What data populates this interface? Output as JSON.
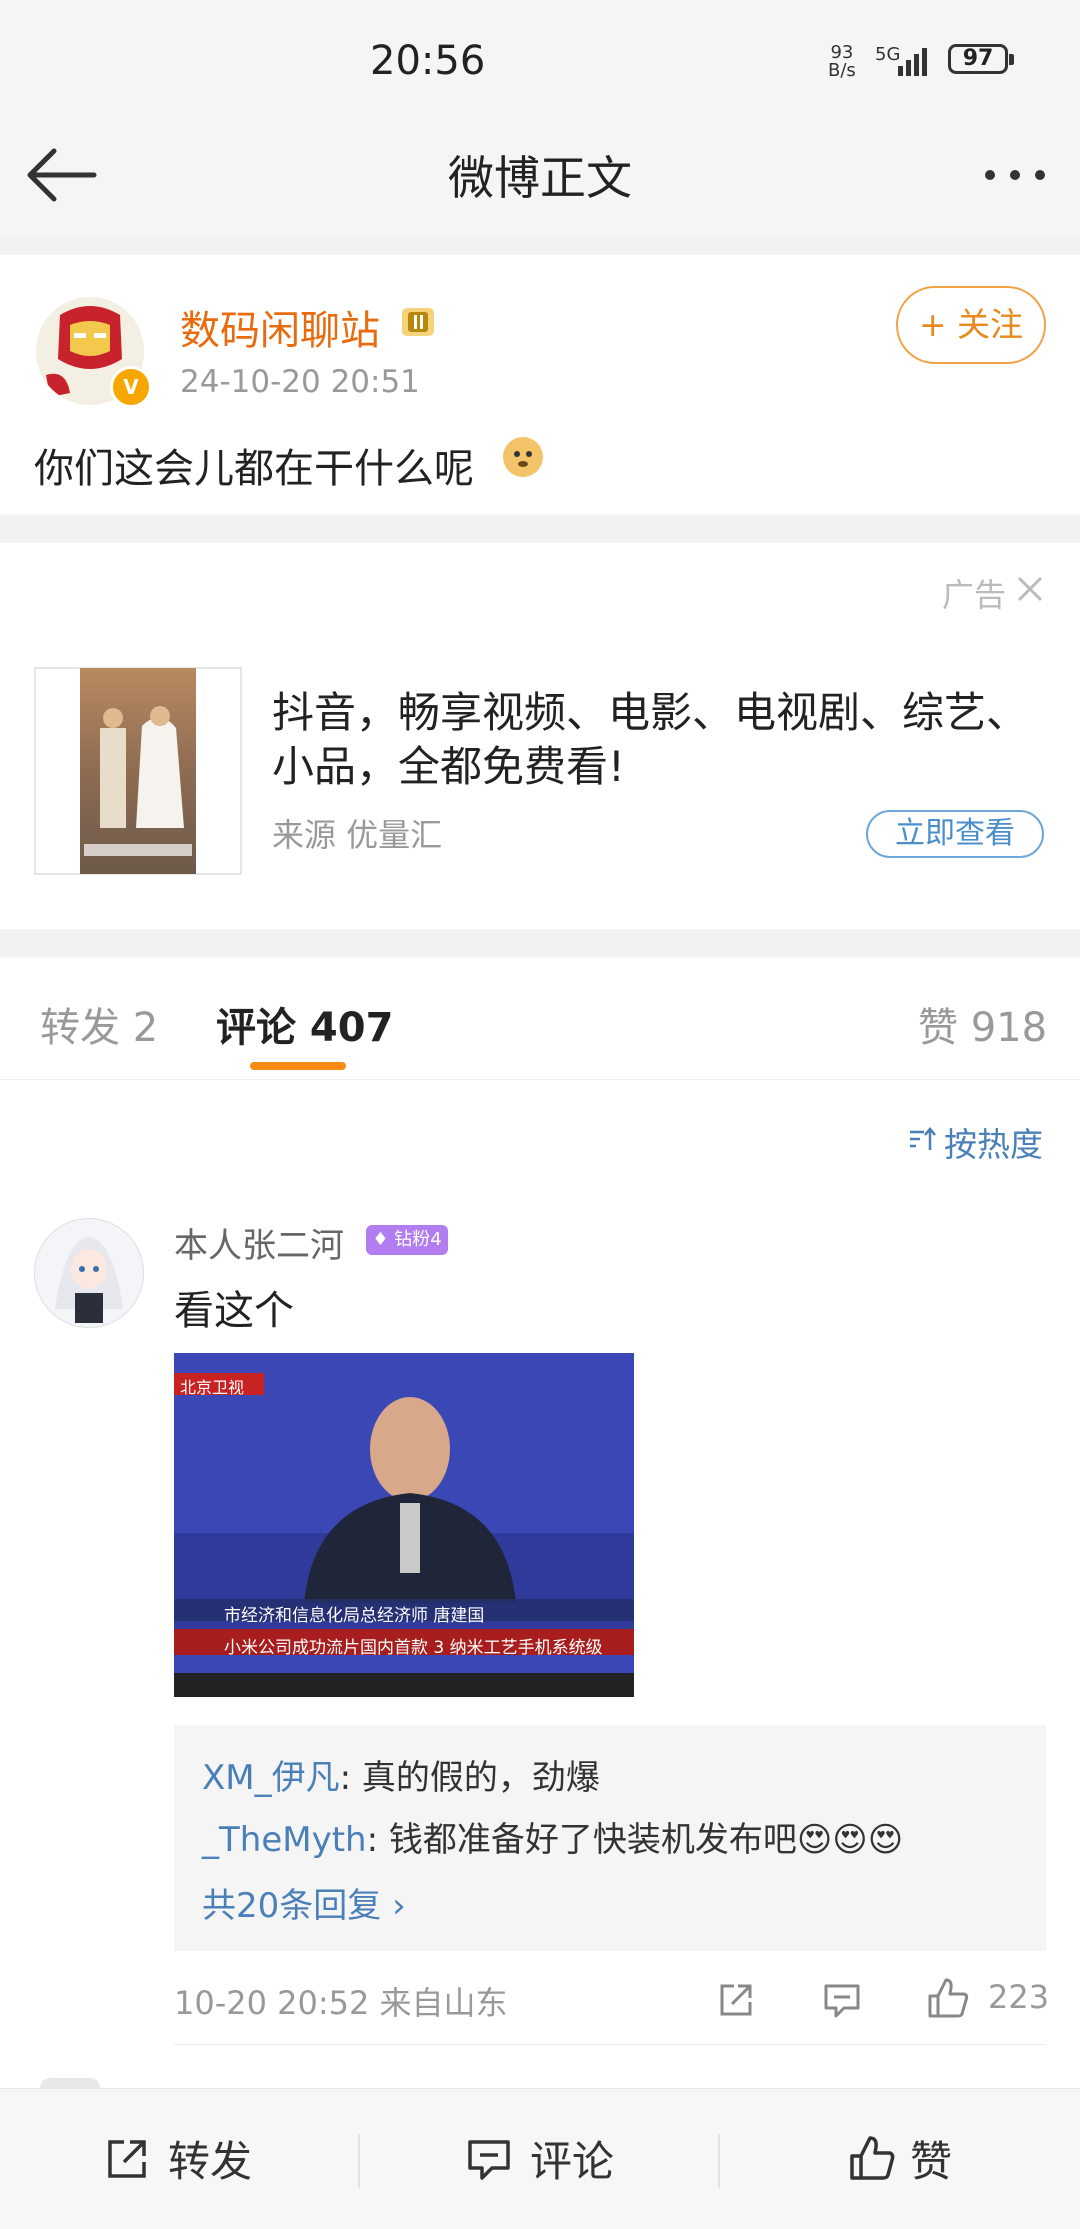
{
  "status": {
    "time": "20:56",
    "net_speed_top": "93",
    "net_speed_bottom": "B/s",
    "network": "5G",
    "battery": "97"
  },
  "nav": {
    "title": "微博正文"
  },
  "post": {
    "username": "数码闲聊站",
    "time": "24-10-20 20:51",
    "follow_label": "+ 关注",
    "text": "你们这会儿都在干什么呢"
  },
  "ad": {
    "label": "广告",
    "title": "抖音，畅享视频、电影、电视剧、综艺、小品，全都免费看!",
    "source": "来源 优量汇",
    "button": "立即查看"
  },
  "tabs": {
    "repost": "转发 2",
    "comment": "评论 407",
    "like": "赞 918"
  },
  "sort": {
    "label": "按热度"
  },
  "comment": {
    "username": "本人张二河",
    "badge": "钻粉4",
    "text": "看这个",
    "image_caption_top": "北京卫视",
    "image_caption_1": "市经济和信息化局总经济师 唐建国",
    "image_caption_2": "小米公司成功流片国内首款 3 纳米工艺手机系统级",
    "replies": [
      {
        "user": "XM_伊凡",
        "text": ": 真的假的，劲爆"
      },
      {
        "user": "_TheMyth",
        "text": ": 钱都准备好了快装机发布吧😍😍😍"
      }
    ],
    "more_replies": "共20条回复 ›",
    "meta": "10-20 20:52  来自山东",
    "like_count": "223"
  },
  "bottom": {
    "repost": "转发",
    "comment": "评论",
    "like": "赞"
  },
  "colors": {
    "accent_orange": "#f78a12",
    "link_blue": "#4a7fb8",
    "username_orange": "#e86b0e"
  }
}
